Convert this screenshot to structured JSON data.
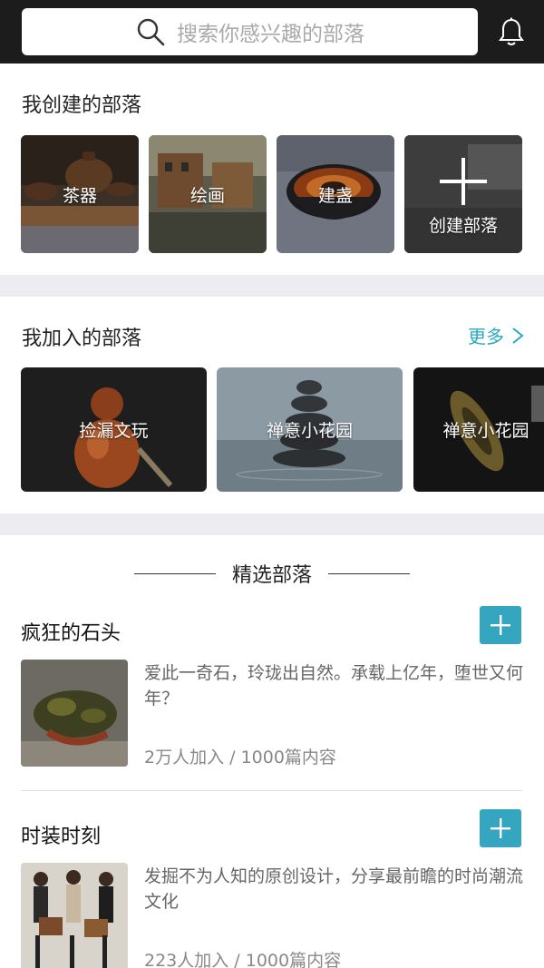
{
  "search": {
    "placeholder": "搜索你感兴趣的部落"
  },
  "created": {
    "title": "我创建的部落",
    "tiles": [
      {
        "label": "茶器"
      },
      {
        "label": "绘画"
      },
      {
        "label": "建盏"
      },
      {
        "label": "创建部落"
      }
    ]
  },
  "joined": {
    "title": "我加入的部落",
    "more": "更多",
    "tiles": [
      {
        "label": "捡漏文玩"
      },
      {
        "label": "禅意小花园"
      },
      {
        "label": "禅意小花园"
      }
    ]
  },
  "featured": {
    "title": "精选部落",
    "items": [
      {
        "name": "疯狂的石头",
        "desc": "爱此一奇石，玲珑出自然。承载上亿年，堕世又何年？",
        "stats": "2万人加入 / 1000篇内容"
      },
      {
        "name": "时装时刻",
        "desc": "发掘不为人知的原创设计，分享最前瞻的时尚潮流文化",
        "stats": "223人加入 / 1000篇内容"
      }
    ]
  },
  "colors": {
    "accent": "#2aa7c2",
    "button": "#34a6bf",
    "topbar": "#1c1c1c"
  },
  "icons": [
    "search-icon",
    "bell-icon",
    "chevron-right-icon",
    "plus-icon"
  ]
}
